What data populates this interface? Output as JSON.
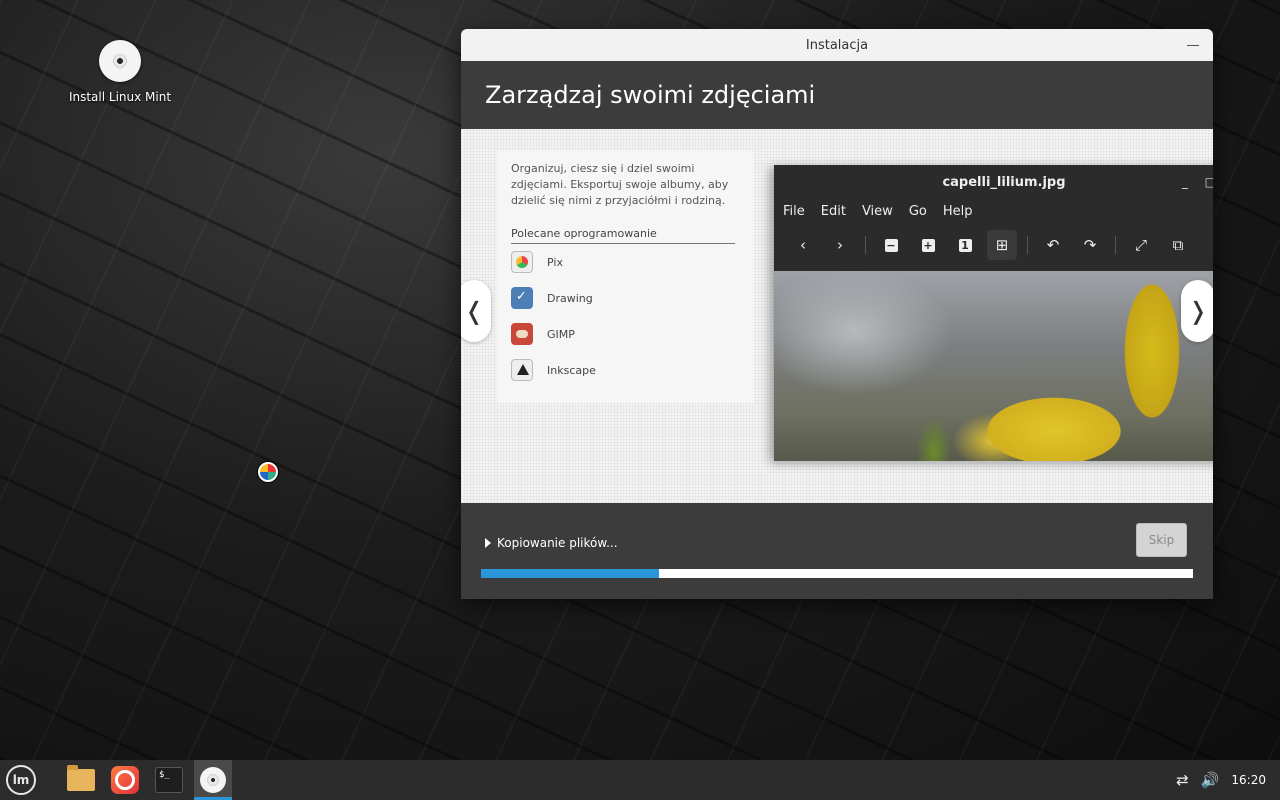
{
  "desktop": {
    "icon_label": "Install Linux Mint"
  },
  "window": {
    "title": "Instalacja",
    "header_title": "Zarządzaj swoimi zdjęciami",
    "slide": {
      "description": "Organizuj, ciesz się i dziel swoimi zdjęciami. Eksportuj swoje albumy, aby dzielić się nimi z przyjaciółmi i rodziną.",
      "recommended_title": "Polecane oprogramowanie",
      "apps": [
        {
          "label": "Pix",
          "icon": "pix-icon"
        },
        {
          "label": "Drawing",
          "icon": "drawing-icon"
        },
        {
          "label": "GIMP",
          "icon": "gimp-icon"
        },
        {
          "label": "Inkscape",
          "icon": "inkscape-icon"
        }
      ],
      "prev_arrow": "❬",
      "next_arrow": "❭",
      "viewer": {
        "title": "capelli_lilium.jpg",
        "menu": [
          "File",
          "Edit",
          "View",
          "Go",
          "Help"
        ],
        "toolbar": {
          "back": "‹",
          "forward": "›",
          "zoom_out": "−",
          "zoom_in": "+",
          "actual_size": "1",
          "fit": "⊞",
          "rotate_left": "↶",
          "rotate_right": "↷",
          "fullscreen": "⤢",
          "slideshow": "⧉"
        },
        "window_controls": {
          "minimize": "_",
          "maximize": "□"
        }
      }
    },
    "progress": {
      "label": "Kopiowanie plików...",
      "fraction": 0.25,
      "bar_color": "#2a95d9"
    },
    "skip_label": "Skip"
  },
  "taskbar": {
    "menu_logo": "lm",
    "terminal_prompt": "$_",
    "clock": "16:20",
    "network_icon": "⇄",
    "volume_icon": "🔊"
  }
}
